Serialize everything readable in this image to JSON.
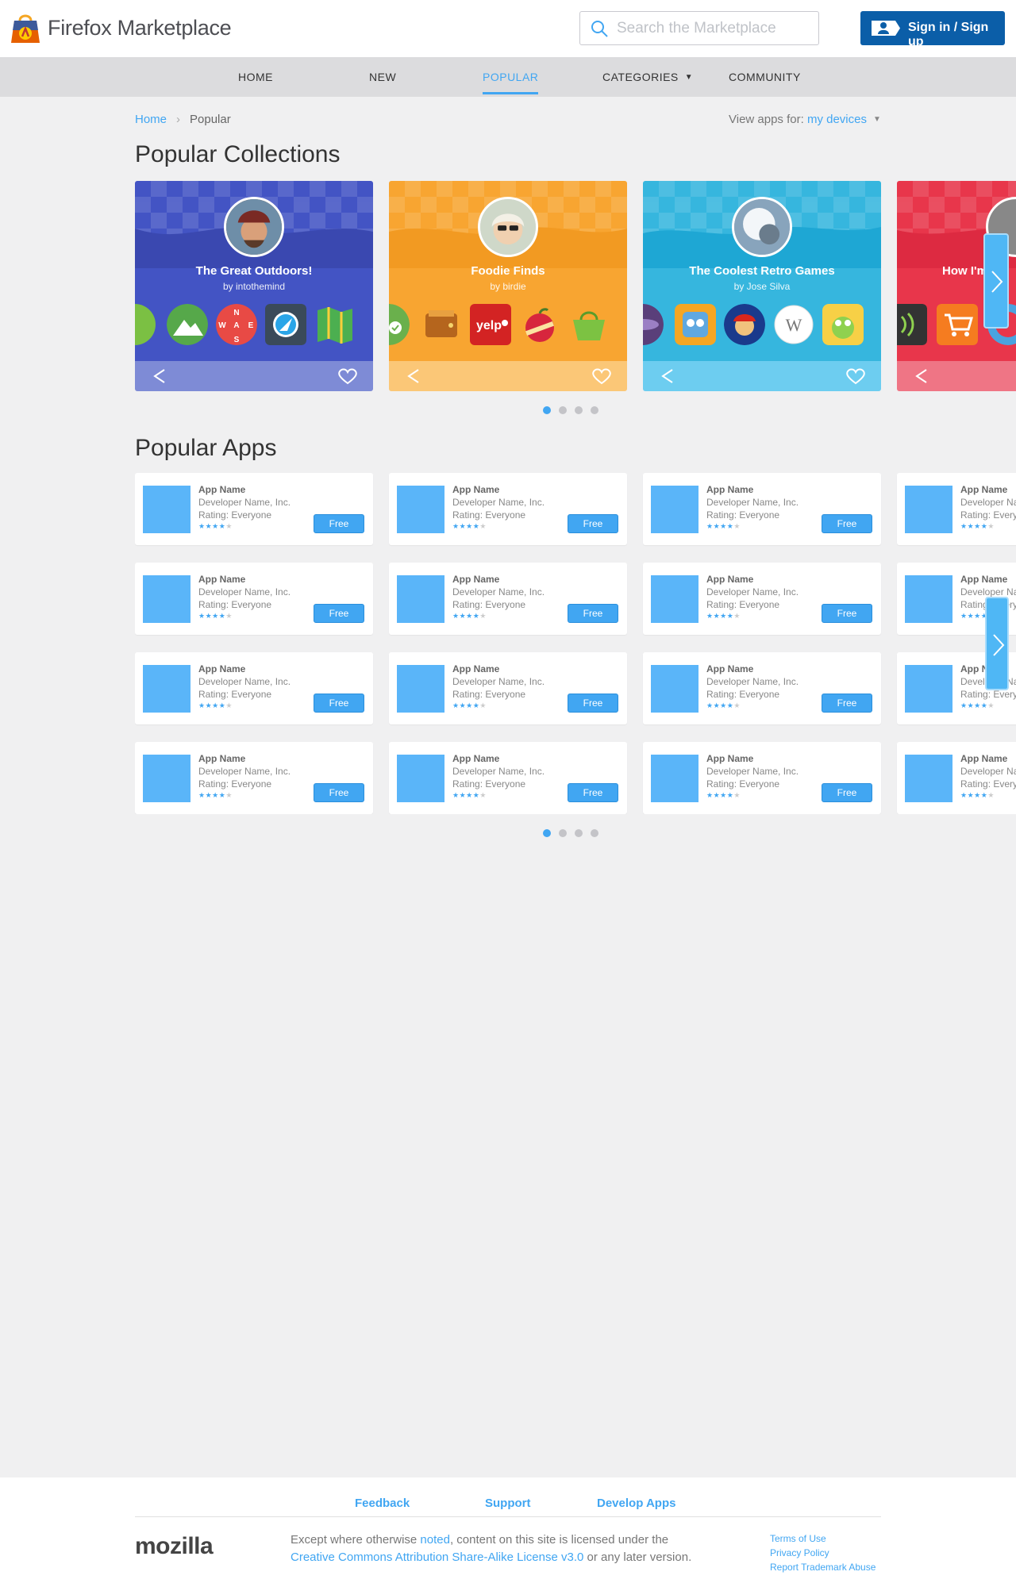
{
  "header": {
    "brand": "Firefox Marketplace",
    "search_placeholder": "Search the Marketplace",
    "signin_label": "Sign in / Sign up"
  },
  "nav": {
    "items": [
      {
        "label": "HOME"
      },
      {
        "label": "NEW"
      },
      {
        "label": "POPULAR",
        "active": true
      },
      {
        "label": "CATEGORIES"
      },
      {
        "label": "COMMUNITY"
      }
    ]
  },
  "breadcrumb": {
    "home": "Home",
    "current": "Popular"
  },
  "view_apps": {
    "label": "View apps for:",
    "value": "my devices"
  },
  "collections": {
    "heading": "Popular Collections",
    "items": [
      {
        "title": "The Great Outdoors!",
        "author": "by intothemind",
        "color": "#4354c4",
        "bar": "#7e8bd6"
      },
      {
        "title": "Foodie Finds",
        "author": "by birdie",
        "color": "#f8a531",
        "bar": "#fbc777"
      },
      {
        "title": "The Coolest Retro Games",
        "author": "by Jose Silva",
        "color": "#36b6de",
        "bar": "#6dcdf0"
      },
      {
        "title": "How I'm",
        "author": "",
        "color": "#e8364b",
        "bar": "#ef7585"
      }
    ],
    "pager": {
      "count": 4,
      "active": 0
    }
  },
  "apps": {
    "heading": "Popular Apps",
    "card": {
      "name": "App Name",
      "developer": "Developer Name, Inc.",
      "rating": "Rating: Everyone",
      "stars": 4,
      "price": "Free"
    },
    "rows": 4,
    "cols": 4,
    "pager": {
      "count": 4,
      "active": 0
    }
  },
  "footer": {
    "links": [
      "Feedback",
      "Support",
      "Develop Apps"
    ],
    "logo": "mozilla",
    "license_prefix": "Except where otherwise",
    "license_noted": "noted",
    "license_mid": ", content on this site is licensed under the",
    "license_link": "Creative Commons Attribution Share-Alike License v3.0",
    "license_suffix": " or any later version.",
    "legal": [
      "Terms of Use",
      "Privacy Policy",
      "Report Trademark Abuse"
    ]
  }
}
